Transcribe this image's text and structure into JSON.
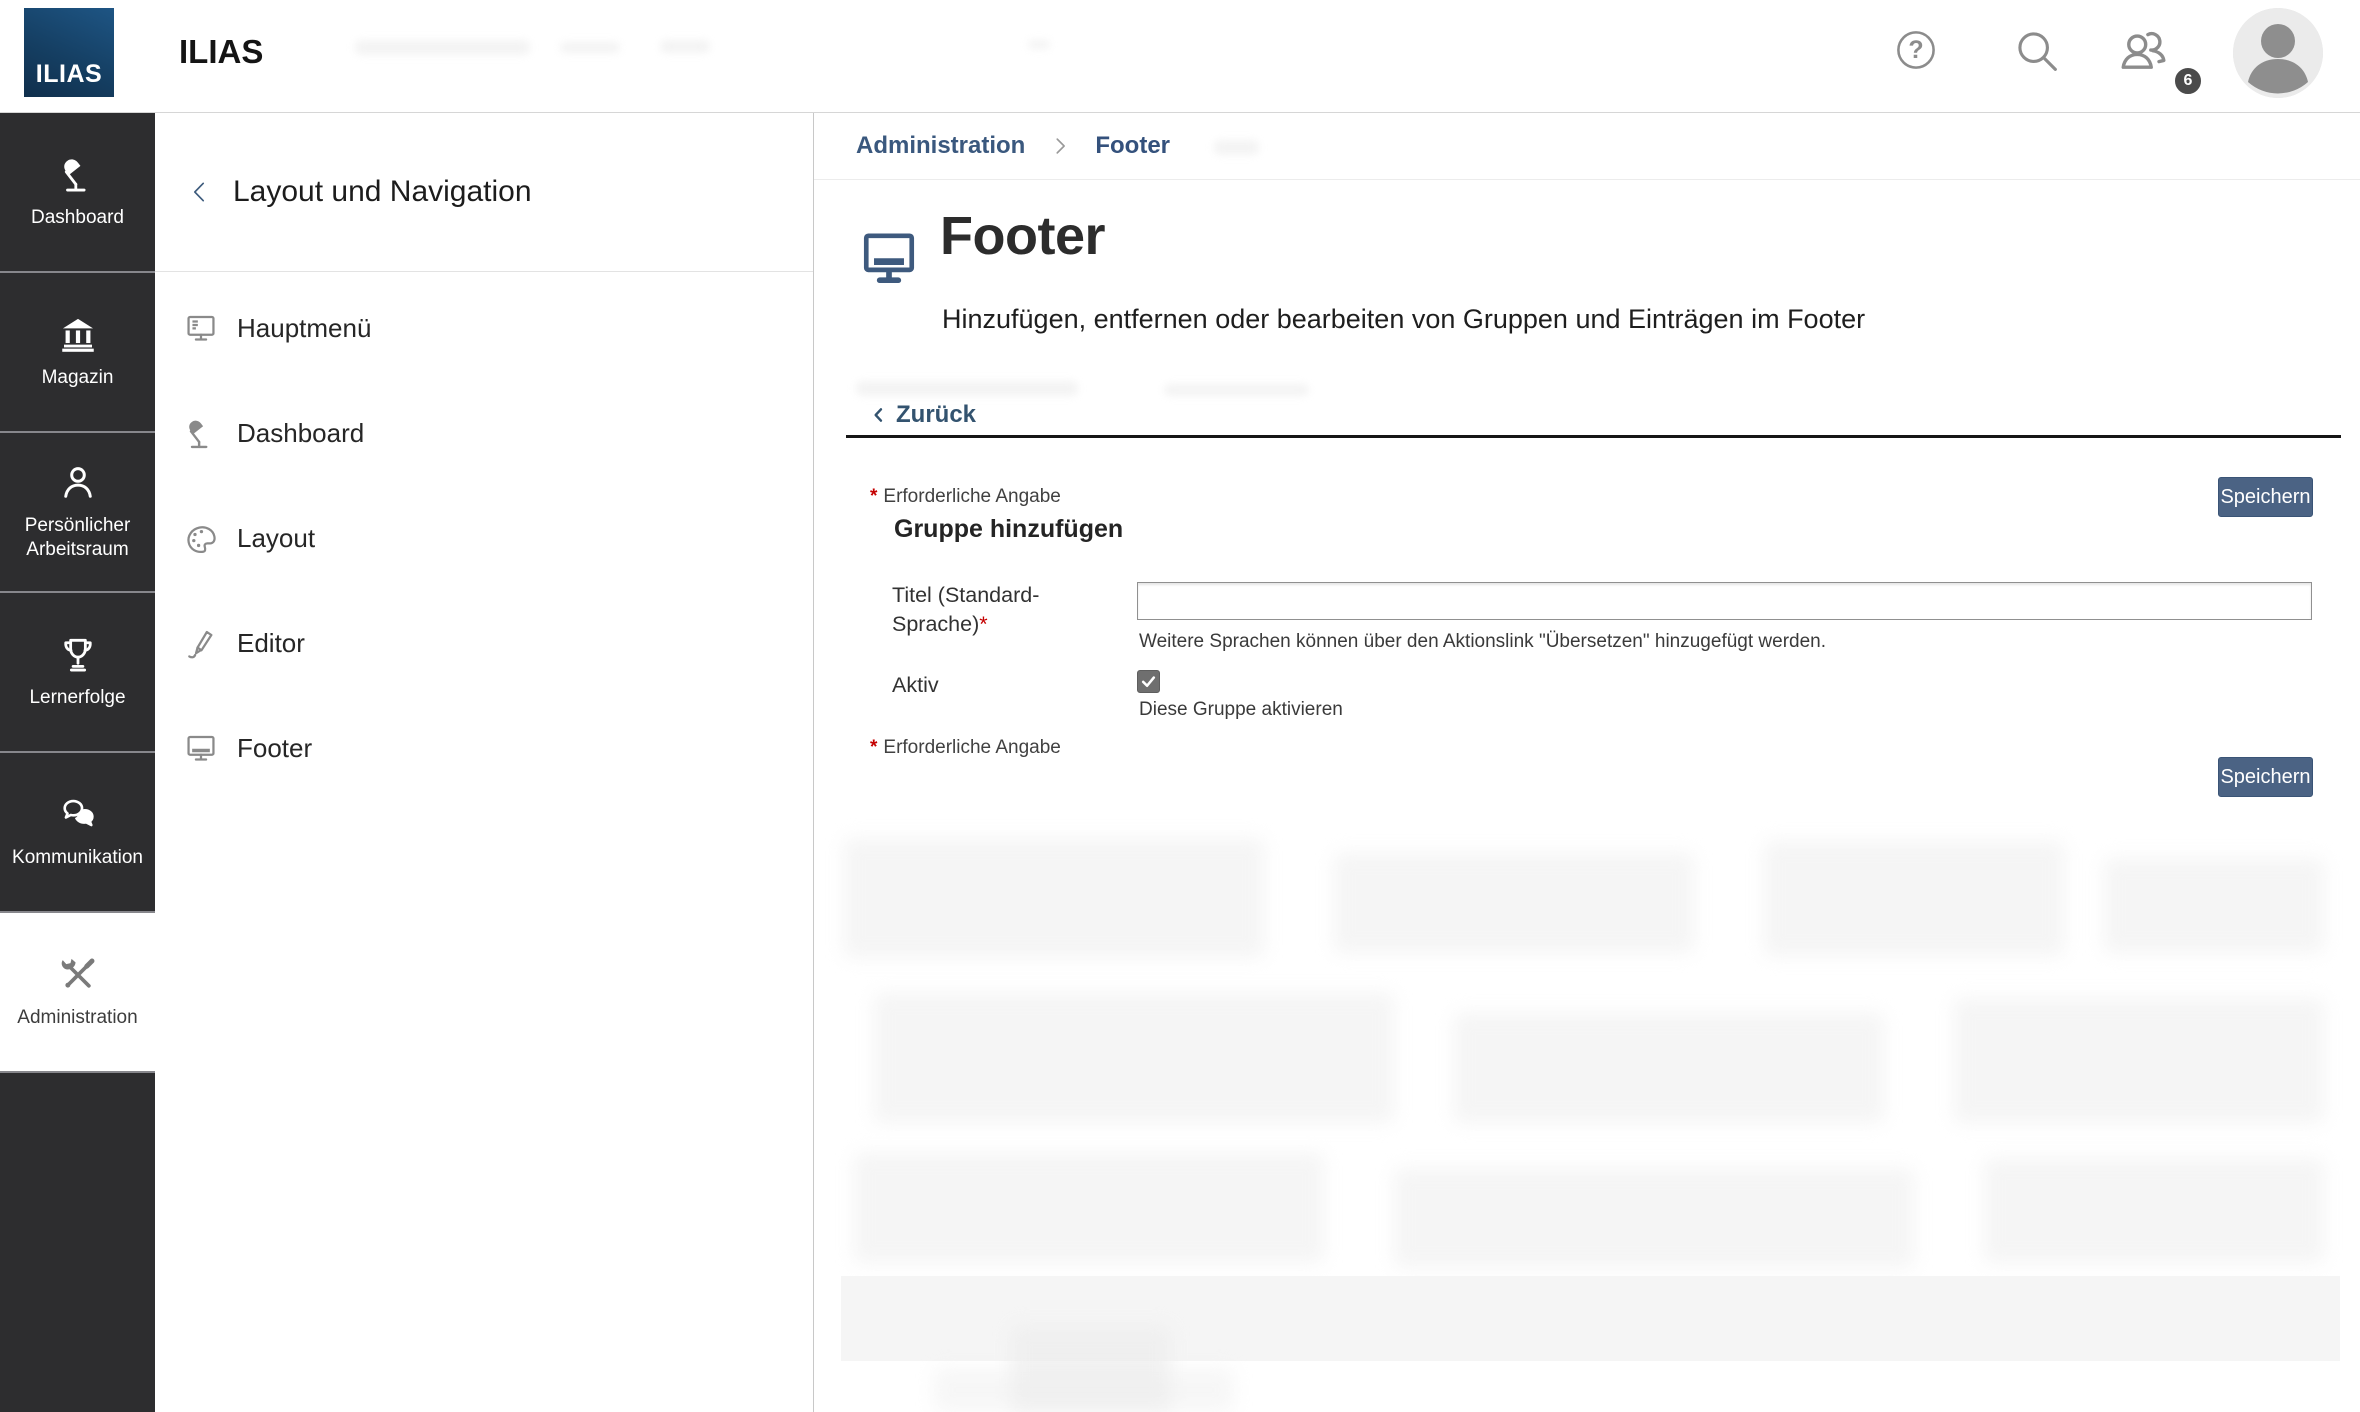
{
  "topbar": {
    "logo_text": "ILIAS",
    "app_title": "ILIAS",
    "help_glyph": "?",
    "notification_count": "6"
  },
  "sidebar": {
    "items": [
      {
        "label": "Dashboard"
      },
      {
        "label": "Magazin"
      },
      {
        "label": "Persönlicher Arbeitsraum"
      },
      {
        "label": "Lernerfolge"
      },
      {
        "label": "Kommunikation"
      },
      {
        "label": "Administration"
      }
    ],
    "active_item": "Administration"
  },
  "panel": {
    "title": "Layout und Navigation",
    "items": [
      {
        "label": "Hauptmenü"
      },
      {
        "label": "Dashboard"
      },
      {
        "label": "Layout"
      },
      {
        "label": "Editor"
      },
      {
        "label": "Footer"
      }
    ]
  },
  "breadcrumb": {
    "level1": "Administration",
    "level2": "Footer"
  },
  "page": {
    "title": "Footer",
    "description": "Hinzufügen, entfernen oder bearbeiten von Gruppen und Einträgen im Footer",
    "back_label": "Zurück"
  },
  "form": {
    "required_marker": "*",
    "required_note": "Erforderliche Angabe",
    "section_title": "Gruppe hinzufügen",
    "save_label": "Speichern",
    "title_field": {
      "label_line1": "Titel (Standard-",
      "label_line2": "Sprache)",
      "value": "",
      "help": "Weitere Sprachen können über den Aktionslink \"Übersetzen\" hinzugefügt werden."
    },
    "active_field": {
      "label": "Aktiv",
      "checked": true,
      "help": "Diese Gruppe aktivieren"
    }
  },
  "colors": {
    "accent_blue": "#3e5a7e",
    "button_bg": "#4b6384",
    "logo_bg": "#153f63",
    "sidebar_bg": "#2d2d2f",
    "required_red": "#c40000"
  }
}
